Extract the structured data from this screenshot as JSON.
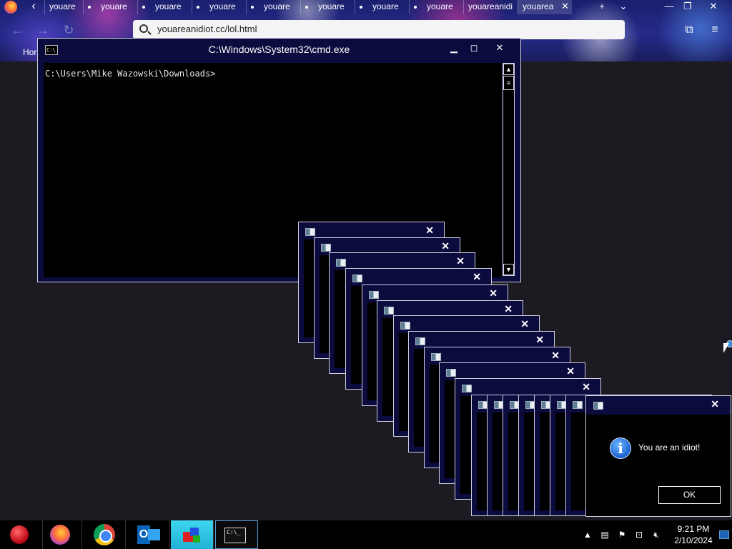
{
  "browser": {
    "tabs": [
      {
        "label": "youare"
      },
      {
        "label": "youare"
      },
      {
        "label": "youare"
      },
      {
        "label": "youare"
      },
      {
        "label": "youare"
      },
      {
        "label": "youare"
      },
      {
        "label": "youare"
      },
      {
        "label": "youare"
      },
      {
        "label": "youareanidi"
      },
      {
        "label": "youarea"
      }
    ],
    "url": "youareanidiot.cc/lol.html",
    "home_label": "Hor"
  },
  "cmd": {
    "title": "C:\\Windows\\System32\\cmd.exe",
    "prompt": "C:\\Users\\Mike Wazowski\\Downloads>",
    "icon_text": "C:\\"
  },
  "popup": {
    "message": "You are an idiot!",
    "ok_label": "OK",
    "info_glyph": "i"
  },
  "taskbar": {
    "cmd_icon_text": "C:\\_",
    "time": "9:21 PM",
    "date": "2/10/2024"
  },
  "colors": {
    "window_frame": "#0b0b3e",
    "taskbar": "#000000",
    "desktop": "#1c1b22"
  }
}
